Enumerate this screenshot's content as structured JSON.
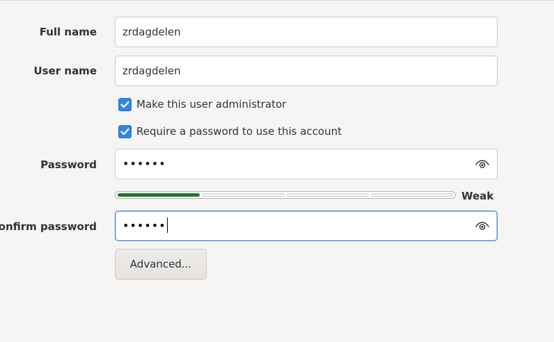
{
  "form": {
    "full_name": {
      "label": "Full name",
      "value": "zrdagdelen"
    },
    "user_name": {
      "label": "User name",
      "value": "zrdagdelen"
    },
    "admin_checkbox": {
      "label": "Make this user administrator",
      "checked": true
    },
    "require_password_checkbox": {
      "label": "Require a password to use this account",
      "checked": true
    },
    "password": {
      "label": "Password",
      "masked_value": "••••••"
    },
    "password_strength": {
      "label": "Weak",
      "level_fraction": 0.25
    },
    "confirm_password": {
      "label": "Confirm password",
      "masked_value": "••••••"
    },
    "advanced_button": {
      "label": "Advanced..."
    }
  },
  "icons": {
    "reveal_password": "eye-icon",
    "checkbox": "checkmark-icon"
  },
  "colors": {
    "accent": "#3584e4",
    "strength_fill": "#1e7a28",
    "background": "#f6f5f4"
  }
}
